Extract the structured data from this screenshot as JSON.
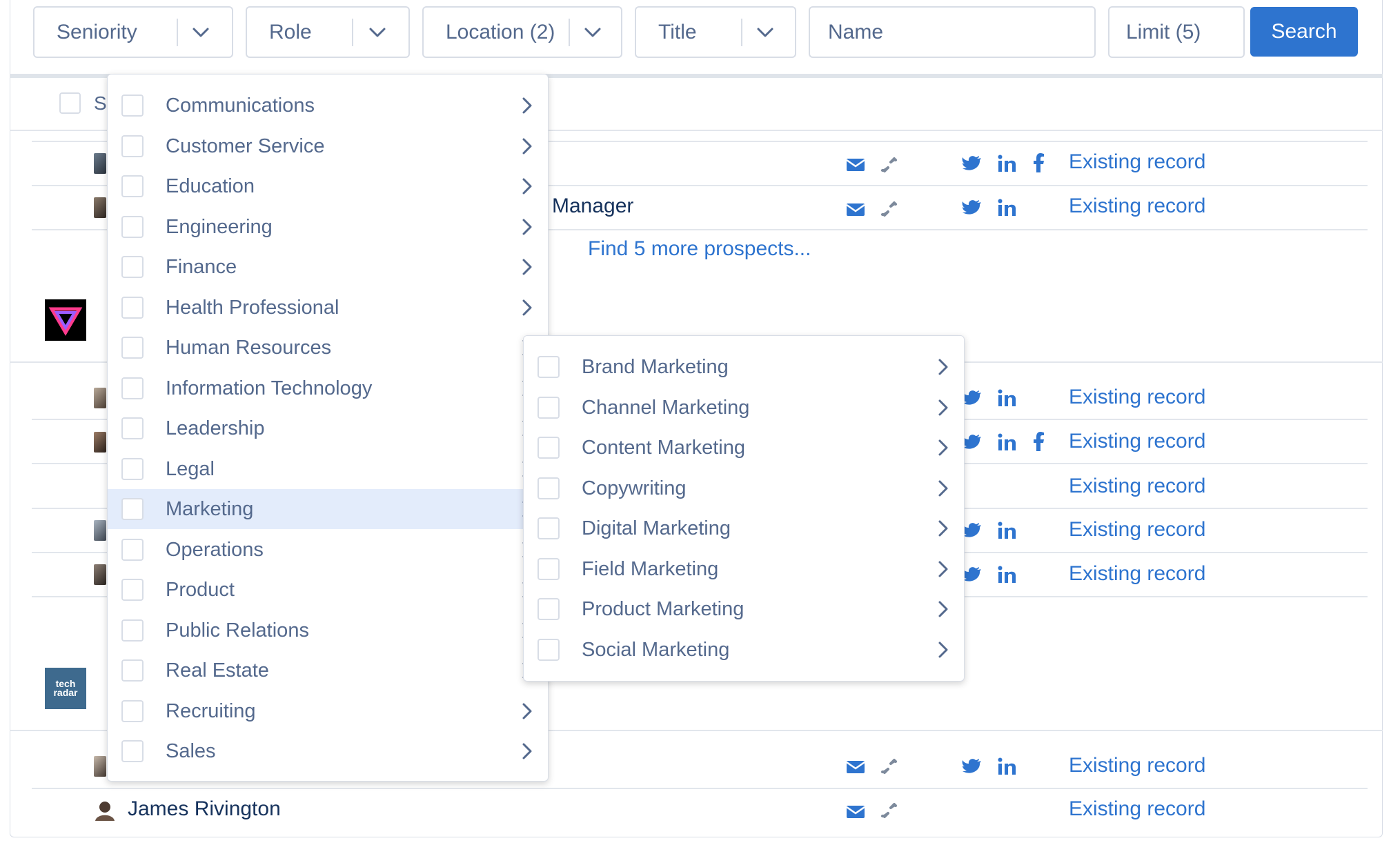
{
  "filters": {
    "seniority": "Seniority",
    "role": "Role",
    "location": "Location (2)",
    "title": "Title",
    "name_placeholder": "Name",
    "limit": "Limit (5)",
    "search": "Search"
  },
  "table": {
    "header_sort_label": "S",
    "rows": [
      {
        "title": "",
        "status": "Existing record"
      },
      {
        "title": "Manager",
        "status": "Existing record"
      },
      {
        "title": "",
        "status": "Existing record"
      },
      {
        "title": "",
        "status": "Existing record"
      },
      {
        "title": "",
        "status": "Existing record"
      },
      {
        "title": "",
        "status": "Existing record"
      },
      {
        "title": "",
        "status": "Existing record"
      },
      {
        "title": "",
        "status": "Existing record"
      },
      {
        "name": "James Rivington",
        "status": "Existing record"
      }
    ],
    "find_more": "Find 5 more prospects..."
  },
  "logos": {
    "techradar_line1": "tech",
    "techradar_line2": "radar"
  },
  "role_menu": {
    "items": [
      "Communications",
      "Customer Service",
      "Education",
      "Engineering",
      "Finance",
      "Health Professional",
      "Human Resources",
      "Information Technology",
      "Leadership",
      "Legal",
      "Marketing",
      "Operations",
      "Product",
      "Public Relations",
      "Real Estate",
      "Recruiting",
      "Sales"
    ],
    "selected": "Marketing"
  },
  "marketing_submenu": {
    "items": [
      "Brand Marketing",
      "Channel Marketing",
      "Content Marketing",
      "Copywriting",
      "Digital Marketing",
      "Field Marketing",
      "Product Marketing",
      "Social Marketing"
    ]
  },
  "colors": {
    "accent": "#2e74cf",
    "menu_selected_bg": "#e3ecfb",
    "border": "#d8dde6",
    "text_muted": "#54698d"
  }
}
